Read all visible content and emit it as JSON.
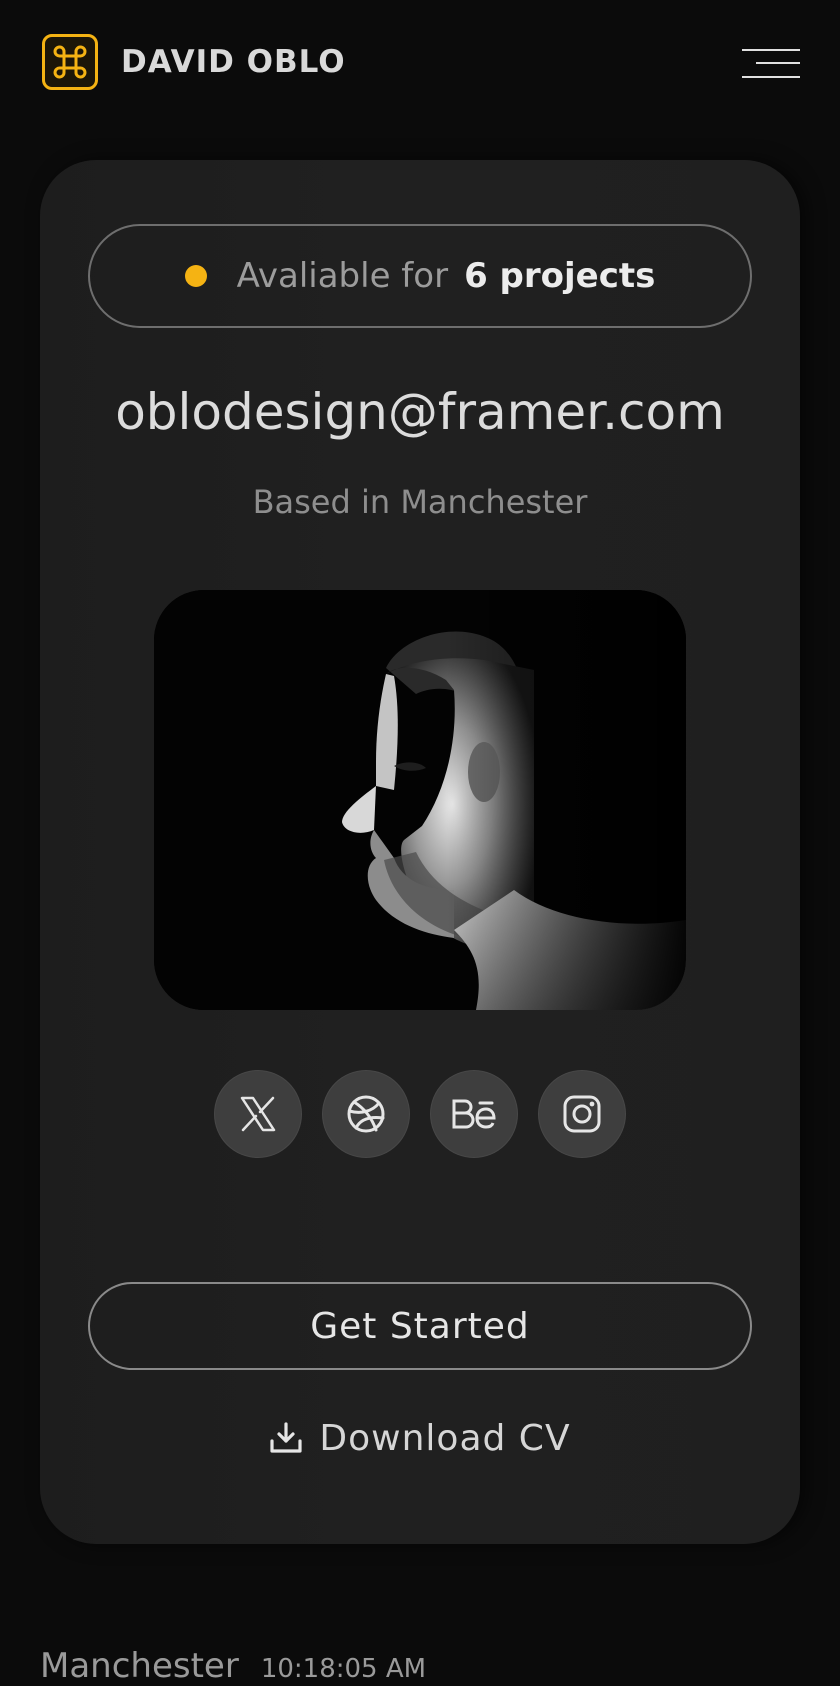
{
  "header": {
    "brand": "DAVID OBLO",
    "logo_icon": "command-icon",
    "menu_icon": "hamburger-menu-icon"
  },
  "card": {
    "availability": {
      "prefix": "Avaliable for",
      "count": "6 projects",
      "dot_color": "#f5b313"
    },
    "email": "oblodesign@framer.com",
    "location": "Based in Manchester",
    "portrait_alt": "portrait",
    "socials": [
      {
        "name": "x",
        "icon": "x-icon"
      },
      {
        "name": "dribbble",
        "icon": "dribbble-icon"
      },
      {
        "name": "behance",
        "icon": "behance-icon"
      },
      {
        "name": "instagram",
        "icon": "instagram-icon"
      }
    ],
    "cta_label": "Get Started",
    "download_label": "Download CV",
    "download_icon": "download-icon"
  },
  "footer": {
    "city": "Manchester",
    "time": "10:18:05 AM"
  },
  "colors": {
    "accent": "#f5b313",
    "background": "#0b0b0b",
    "card": "#1f1f1f"
  }
}
